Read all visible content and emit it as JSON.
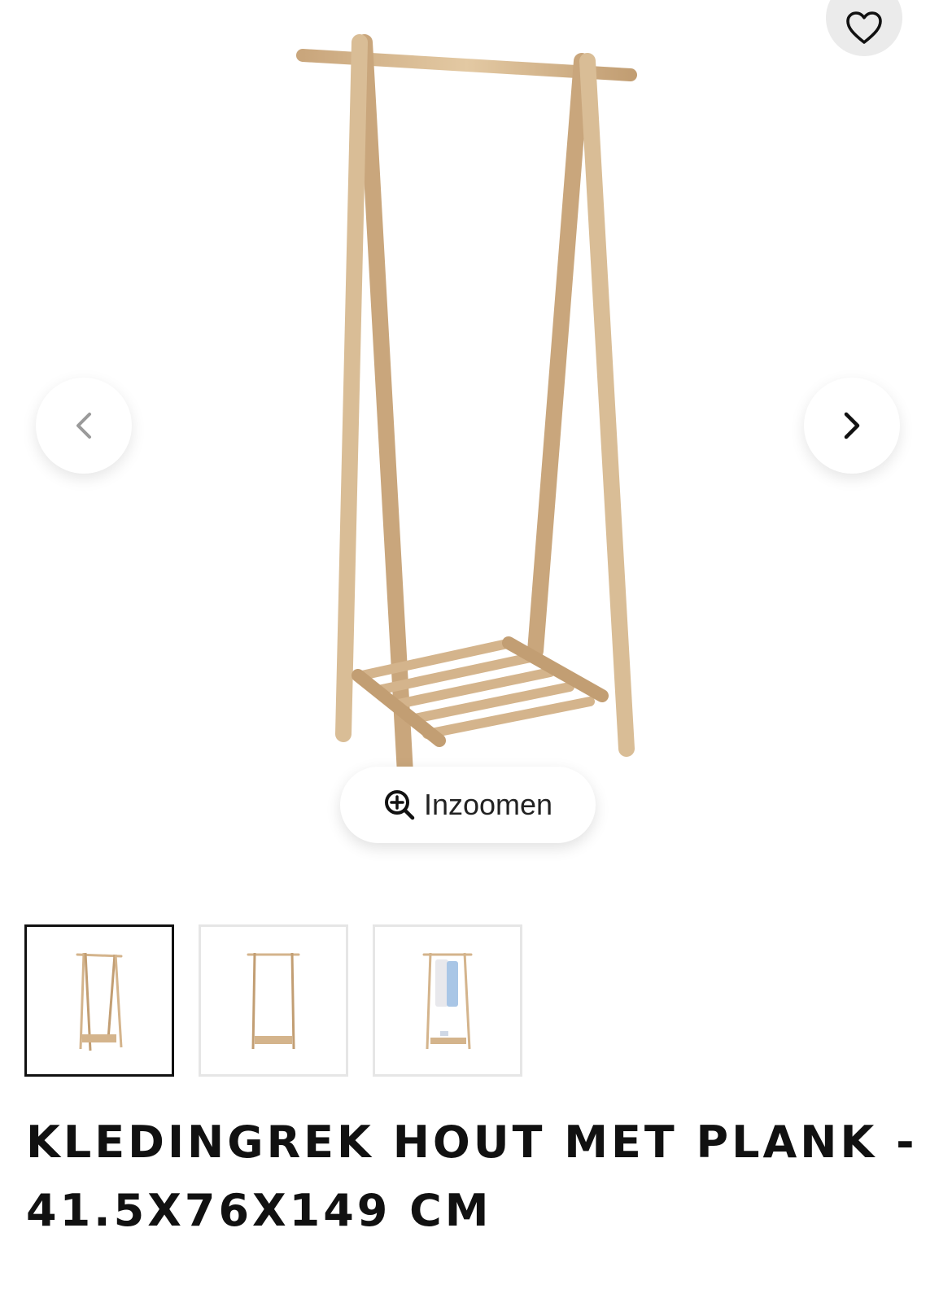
{
  "gallery": {
    "zoom_label": "Inzoomen",
    "favorite_icon": "heart-icon",
    "prev_icon": "chevron-left-icon",
    "next_icon": "chevron-right-icon",
    "zoom_icon": "zoom-in-icon",
    "thumbnails": [
      {
        "subject": "clothing rack front view",
        "active": true
      },
      {
        "subject": "clothing rack side view",
        "active": false
      },
      {
        "subject": "clothing rack with clothes",
        "active": false
      }
    ]
  },
  "product": {
    "title": "KLEDINGREK HOUT MET PLANK - 41.5X76X149 CM"
  },
  "colors": {
    "wood": "#d4b48c",
    "wood_dark": "#b8936a",
    "favorite_bg": "#ebebeb",
    "active_border": "#111111"
  }
}
